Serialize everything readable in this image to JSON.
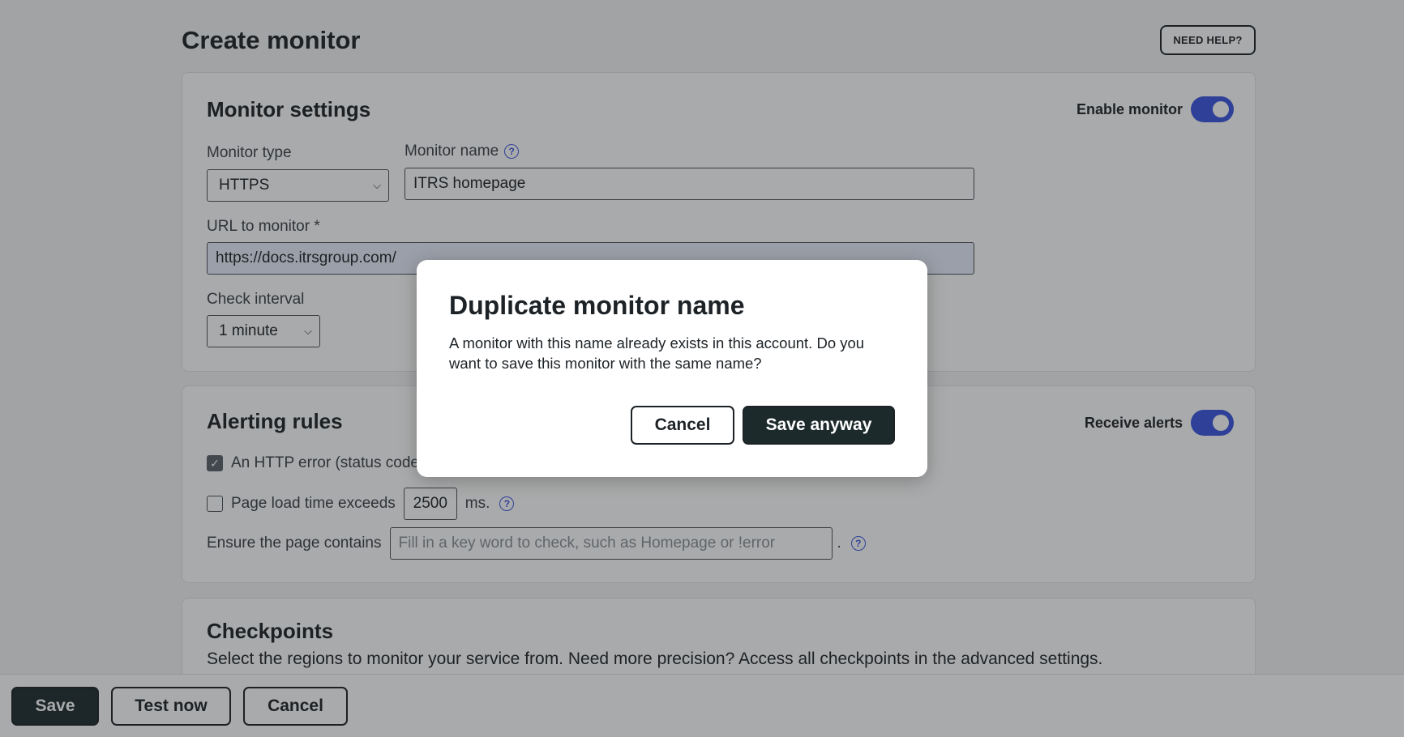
{
  "header": {
    "title": "Create monitor",
    "help_label": "NEED HELP?"
  },
  "monitor_settings": {
    "title": "Monitor settings",
    "enable_label": "Enable monitor",
    "enable_on": true,
    "type_label": "Monitor type",
    "type_value": "HTTPS",
    "name_label": "Monitor name",
    "name_value": "ITRS homepage",
    "url_label": "URL to monitor *",
    "url_value": "https://docs.itrsgroup.com/",
    "interval_label": "Check interval",
    "interval_value": "1 minute"
  },
  "alerting": {
    "title": "Alerting rules",
    "receive_label": "Receive alerts",
    "receive_on": true,
    "http_error_label": "An HTTP error (status code",
    "http_error_checked": true,
    "load_time_label": "Page load time exceeds",
    "load_time_value": "2500",
    "load_time_unit": "ms.",
    "load_time_checked": false,
    "contains_label": "Ensure the page contains",
    "contains_placeholder": "Fill in a key word to check, such as Homepage or !error",
    "contains_suffix": "."
  },
  "checkpoints": {
    "title": "Checkpoints",
    "description": "Select the regions to monitor your service from. Need more precision? Access all checkpoints in the advanced settings."
  },
  "footer": {
    "save_label": "Save",
    "test_label": "Test now",
    "cancel_label": "Cancel"
  },
  "modal": {
    "title": "Duplicate monitor name",
    "body": "A monitor with this name already exists in this account. Do you want to save this monitor with the same name?",
    "cancel_label": "Cancel",
    "confirm_label": "Save anyway"
  },
  "colors": {
    "accent": "#3b54e0",
    "primary_button": "#1d2a2c"
  },
  "icons": {
    "help": "question-circle-icon",
    "select": "chevron-down-icon",
    "checkbox": "check-icon"
  }
}
